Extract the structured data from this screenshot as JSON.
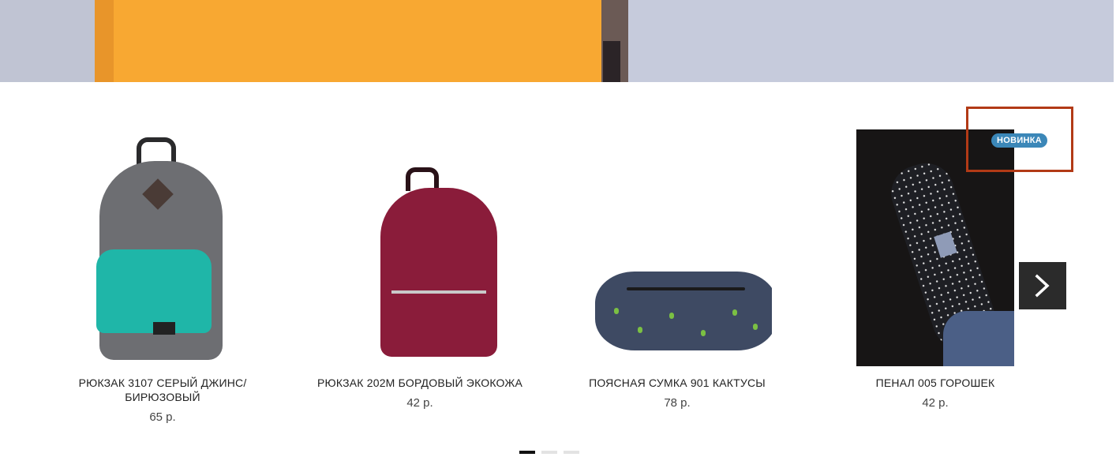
{
  "colors": {
    "badge": "#3b87b8",
    "highlight_box": "#b23a16",
    "arrow_bg": "#2b2b2b",
    "dot_active": "#111111",
    "dot_inactive": "#e3e3e3"
  },
  "products": [
    {
      "title": "РЮКЗАК 3107 СЕРЫЙ ДЖИНС/ БИРЮЗОВЫЙ",
      "price": "65 р."
    },
    {
      "title": "РЮКЗАК 202М БОРДОВЫЙ ЭКОКОЖА",
      "price": "42 р."
    },
    {
      "title": "ПОЯСНАЯ СУМКА 901 КАКТУСЫ",
      "price": "78 р."
    },
    {
      "title": "ПЕНАЛ 005 ГОРОШЕК",
      "price": "42 р.",
      "badge": "НОВИНКА"
    }
  ],
  "navigation": {
    "next_icon": "chevron-right-icon",
    "pages": 3,
    "active_page": 1
  }
}
